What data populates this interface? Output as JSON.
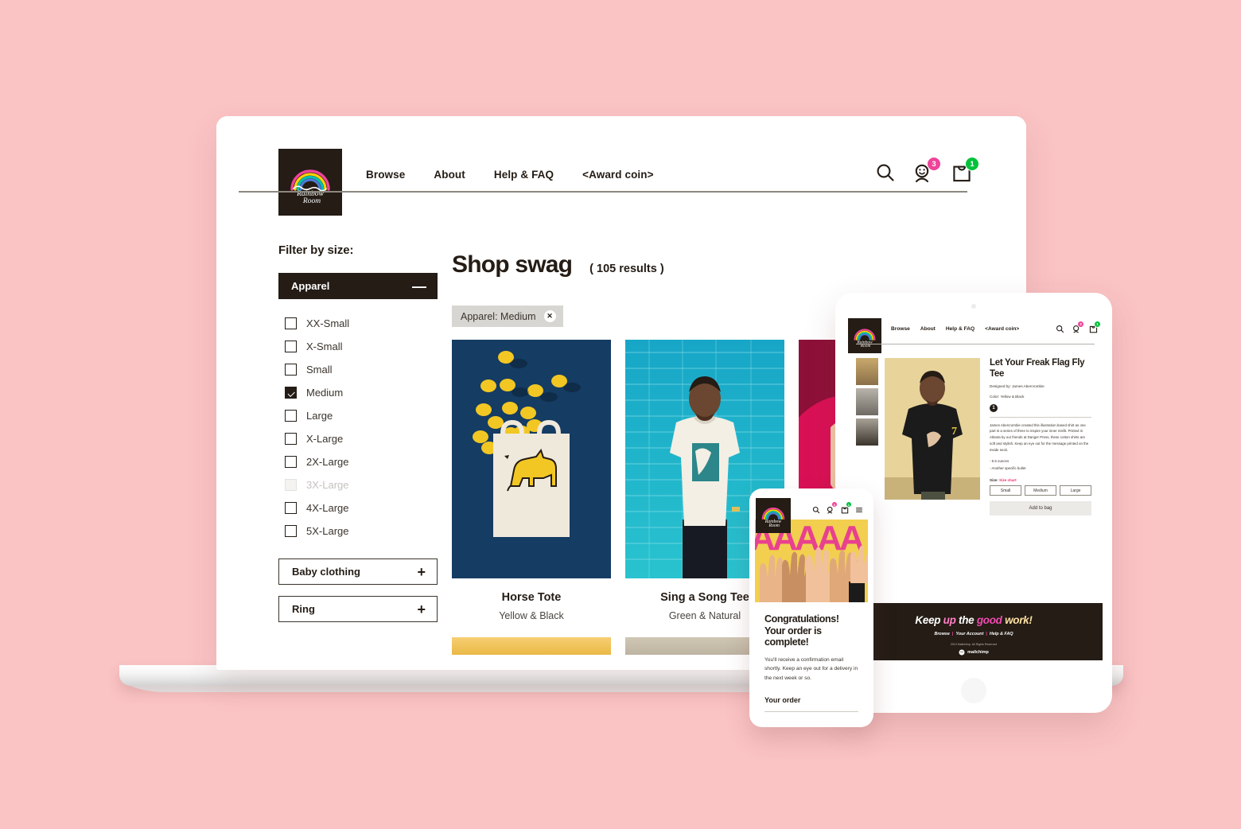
{
  "background_color": "#fac3c4",
  "brand": {
    "logo_text_line1": "Rainbow",
    "logo_text_line2": "Room",
    "logo_bg": "#241c15"
  },
  "laptop": {
    "header": {
      "nav": [
        {
          "label": "Browse"
        },
        {
          "label": "About"
        },
        {
          "label": "Help & FAQ"
        },
        {
          "label": "<Award coin>"
        }
      ],
      "icons": [
        {
          "name": "search-icon",
          "badge": null
        },
        {
          "name": "account-smiley-icon",
          "badge": "3",
          "badge_color": "#ee4499"
        },
        {
          "name": "shopping-bag-icon",
          "badge": "1",
          "badge_color": "#00c23a"
        }
      ]
    },
    "sidebar": {
      "title": "Filter by size:",
      "apparel_group": {
        "label": "Apparel",
        "toggle": "—",
        "expanded": true
      },
      "sizes": [
        {
          "label": "XX-Small",
          "checked": false,
          "disabled": false
        },
        {
          "label": "X-Small",
          "checked": false,
          "disabled": false
        },
        {
          "label": "Small",
          "checked": false,
          "disabled": false
        },
        {
          "label": "Medium",
          "checked": true,
          "disabled": false
        },
        {
          "label": "Large",
          "checked": false,
          "disabled": false
        },
        {
          "label": "X-Large",
          "checked": false,
          "disabled": false
        },
        {
          "label": "2X-Large",
          "checked": false,
          "disabled": false
        },
        {
          "label": "3X-Large",
          "checked": false,
          "disabled": true
        },
        {
          "label": "4X-Large",
          "checked": false,
          "disabled": false
        },
        {
          "label": "5X-Large",
          "checked": false,
          "disabled": false
        }
      ],
      "collapsed_groups": [
        {
          "label": "Baby clothing",
          "toggle": "+"
        },
        {
          "label": "Ring",
          "toggle": "+"
        }
      ]
    },
    "main": {
      "heading": "Shop swag",
      "results": "( 105 results )",
      "active_filter": {
        "label": "Apparel: Medium",
        "remove": "✕"
      },
      "products": [
        {
          "name": "Horse Tote",
          "color": "Yellow & Black",
          "image": "canvas-tote-with-yellow-horse-and-lemons-on-navy"
        },
        {
          "name": "Sing a Song Tee",
          "color": "Green & Natural",
          "image": "man-in-white-tee-against-teal-brick-wall"
        },
        {
          "name": "",
          "color": "",
          "image": "person-on-magenta-background"
        }
      ],
      "products_row2": [
        {
          "image": "golden-yellow-product"
        },
        {
          "image": "beige-tan-product"
        }
      ]
    }
  },
  "tablet": {
    "header": {
      "nav": [
        {
          "label": "Browse"
        },
        {
          "label": "About"
        },
        {
          "label": "Help & FAQ"
        },
        {
          "label": "<Award coin>"
        }
      ],
      "icons": [
        {
          "name": "search-icon",
          "badge": null
        },
        {
          "name": "account-smiley-icon",
          "badge": "3",
          "badge_color": "#ee4499"
        },
        {
          "name": "shopping-bag-icon",
          "badge": "1",
          "badge_color": "#00c23a"
        }
      ]
    },
    "product": {
      "title": "Let Your Freak Flag Fly Tee",
      "designed_by": "Designed by: James Abercrombie",
      "color": "Color: Yellow & Black",
      "step_number": "1",
      "description": "James Abercrombie created this illustration based shirt as one part in a series of three to inspire your inner misfit. Printed in Atlanta by our friends at Danger Press, these cotton shirts are soft and stylish. Keep an eye out for the message printed on the inside neck.",
      "bullets": [
        "- 5.5 ounces",
        "- Another specific bullet"
      ],
      "size_label": "Size:",
      "size_chart_link": "Size chart",
      "sizes": [
        "Small",
        "Medium",
        "Large"
      ],
      "add_to_bag": "Add to bag",
      "hero_image": "man-in-black-tee-with-yellow-seven-logo",
      "thumbnails": [
        "thumb-black-tee-front",
        "thumb-grey-tee",
        "thumb-black-tee-detail"
      ]
    },
    "footer": {
      "headline_parts": [
        {
          "text": "Keep ",
          "color": "#ffffff"
        },
        {
          "text": "up ",
          "color": "#ff7fc4"
        },
        {
          "text": "the ",
          "color": "#ffffff"
        },
        {
          "text": "good ",
          "color": "#f04bb0"
        },
        {
          "text": "work!",
          "color": "#ffe0a3"
        }
      ],
      "links": [
        "Browse",
        "Your Account",
        "Help & FAQ"
      ],
      "copyright": "2019 Mailchimp. All Rights Reserved",
      "logo_label": "mailchimp"
    }
  },
  "phone": {
    "header_icons": [
      {
        "name": "search-icon",
        "badge": null
      },
      {
        "name": "account-smiley-icon",
        "badge": "3",
        "badge_color": "#ee4499"
      },
      {
        "name": "shopping-bag-icon",
        "badge": "1",
        "badge_color": "#00c23a"
      },
      {
        "name": "hamburger-menu-icon",
        "badge": null
      }
    ],
    "hero_image": "raised-hands-on-yellow-with-pink-letters",
    "hero_text": "AAAAA",
    "heading": "Congratulations! Your order is complete!",
    "body": "You'll receive a confirmation email shortly. Keep an eye out for a delivery in the next week or so.",
    "order_heading": "Your order"
  }
}
